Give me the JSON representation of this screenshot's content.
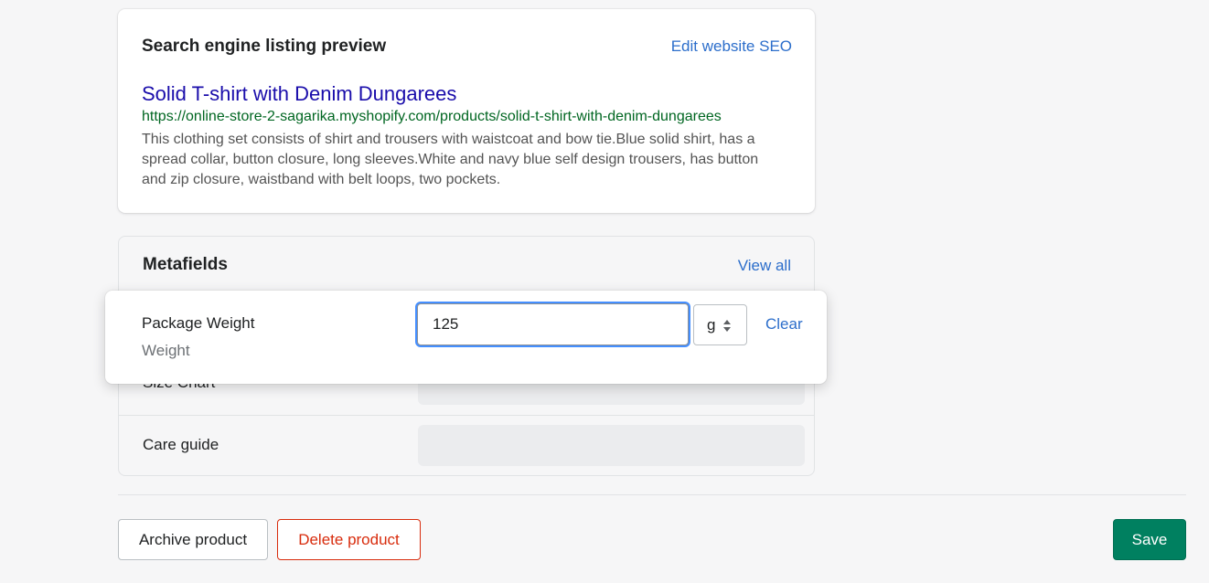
{
  "seo": {
    "title": "Search engine listing preview",
    "edit_link": "Edit website SEO",
    "result_title": "Solid T-shirt with Denim Dungarees",
    "url": "https://online-store-2-sagarika.myshopify.com/products/solid-t-shirt-with-denim-dungarees",
    "description": "This clothing set consists of shirt and trousers with waistcoat and bow tie.Blue solid shirt, has a spread collar, button closure, long sleeves.White and navy blue self design trousers, has button and zip closure, waistband with belt loops, two pockets."
  },
  "metafields": {
    "title": "Metafields",
    "view_all": "View all",
    "rows": [
      {
        "label": "Size Chart"
      },
      {
        "label": "Care guide"
      }
    ],
    "active": {
      "label": "Package Weight",
      "sublabel": "Weight",
      "value": "125",
      "unit": "g",
      "clear_label": "Clear"
    }
  },
  "actions": {
    "archive_label": "Archive product",
    "delete_label": "Delete product",
    "save_label": "Save"
  },
  "colors": {
    "link": "#2c6ecb",
    "primary": "#008060",
    "critical": "#d82c0d",
    "search_title": "#1a0dab",
    "search_url": "#006621"
  },
  "icons": {
    "unit_select": "select-arrows-icon"
  }
}
